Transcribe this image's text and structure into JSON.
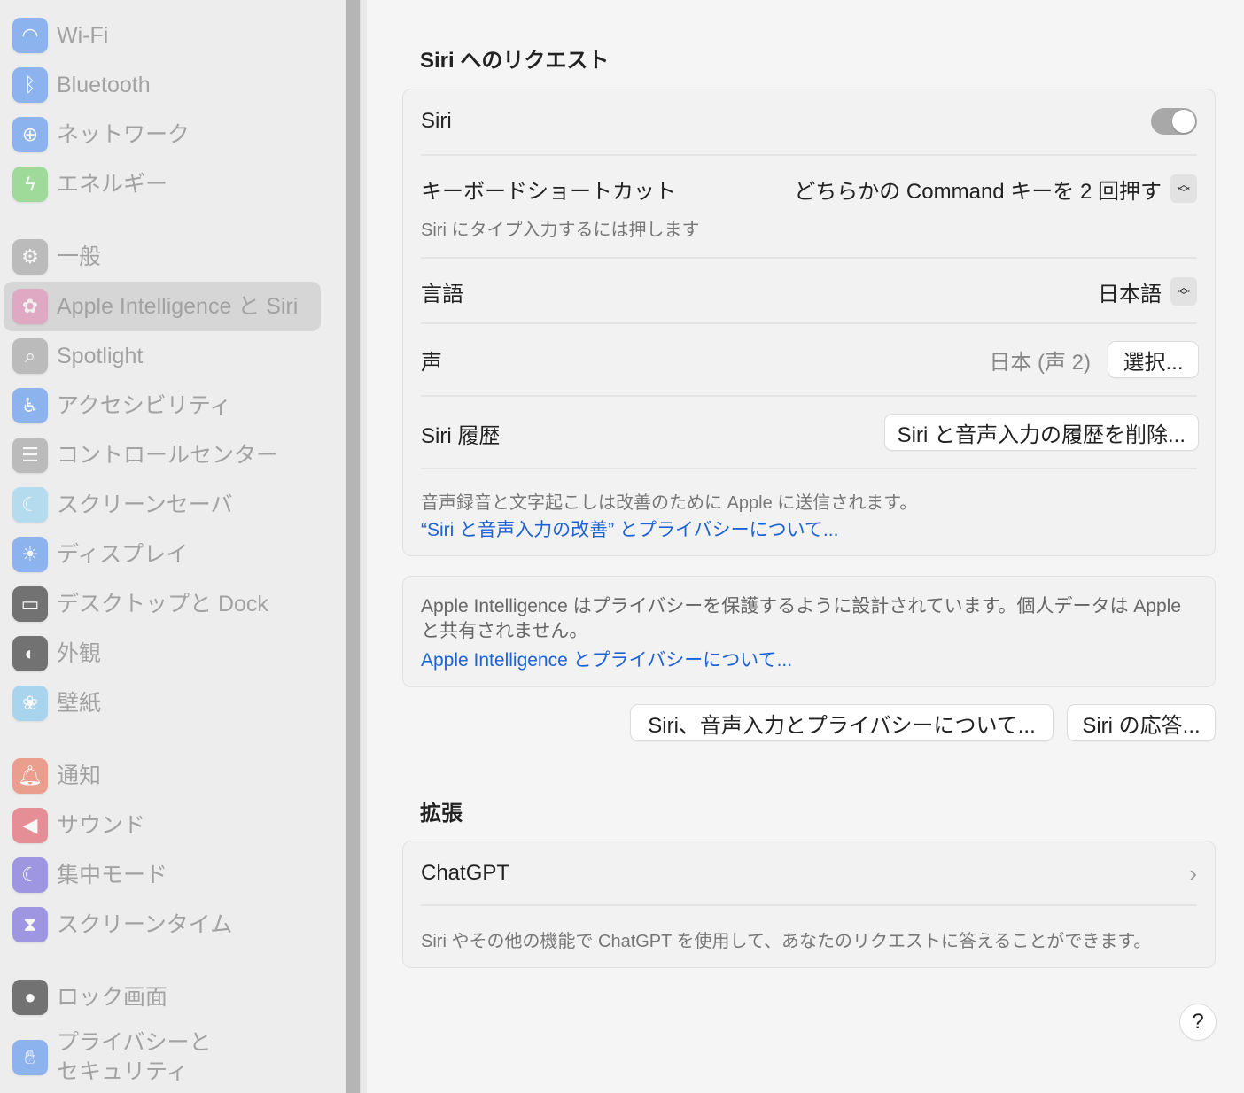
{
  "sidebar": {
    "items": [
      {
        "label": "Wi-Fi",
        "icon": "wifi-icon",
        "color": "#4f8ef0"
      },
      {
        "label": "Bluetooth",
        "icon": "bluetooth-icon",
        "color": "#4f8ef0"
      },
      {
        "label": "ネットワーク",
        "icon": "globe-icon",
        "color": "#4f8ef0"
      },
      {
        "label": "エネルギー",
        "icon": "bolt-icon",
        "color": "#6cce64"
      },
      {
        "label": "一般",
        "icon": "gear-icon",
        "color": "#9a9a9a"
      },
      {
        "label": "Apple Intelligence と Siri",
        "icon": "apple-intelligence-icon",
        "color": "#e58ab8"
      },
      {
        "label": "Spotlight",
        "icon": "magnifier-icon",
        "color": "#9a9a9a"
      },
      {
        "label": "アクセシビリティ",
        "icon": "accessibility-icon",
        "color": "#4f8ef0"
      },
      {
        "label": "コントロールセンター",
        "icon": "toggles-icon",
        "color": "#9a9a9a"
      },
      {
        "label": "スクリーンセーバ",
        "icon": "screensaver-icon",
        "color": "#8fd0f0"
      },
      {
        "label": "ディスプレイ",
        "icon": "sun-icon",
        "color": "#4f8ef0"
      },
      {
        "label": "デスクトップと Dock",
        "icon": "dock-icon",
        "color": "#222222"
      },
      {
        "label": "外観",
        "icon": "appearance-icon",
        "color": "#222222"
      },
      {
        "label": "壁紙",
        "icon": "flower-icon",
        "color": "#7cc4f0"
      },
      {
        "label": "通知",
        "icon": "bell-icon",
        "color": "#e86a50"
      },
      {
        "label": "サウンド",
        "icon": "speaker-icon",
        "color": "#e0505e"
      },
      {
        "label": "集中モード",
        "icon": "moon-icon",
        "color": "#6a5ed8"
      },
      {
        "label": "スクリーンタイム",
        "icon": "hourglass-icon",
        "color": "#6a5ed8"
      },
      {
        "label": "ロック画面",
        "icon": "lock-icon",
        "color": "#222222"
      },
      {
        "label": "プライバシーと\nセキュリティ",
        "icon": "hand-icon",
        "color": "#4f8ef0"
      }
    ]
  },
  "siri_requests": {
    "heading": "Siri へのリクエスト",
    "siri_label": "Siri",
    "siri_on": true,
    "shortcut_label": "キーボードショートカット",
    "shortcut_value": "どちらかの Command キーを 2 回押す",
    "shortcut_sub": "Siri にタイプ入力するには押します",
    "language_label": "言語",
    "language_value": "日本語",
    "voice_label": "声",
    "voice_value": "日本 (声 2)",
    "voice_button": "選択...",
    "history_label": "Siri 履歴",
    "history_button": "Siri と音声入力の履歴を削除...",
    "note": "音声録音と文字起こしは改善のために Apple に送信されます。",
    "note_link": "“Siri と音声入力の改善” とプライバシーについて..."
  },
  "privacy": {
    "text": "Apple Intelligence はプライバシーを保護するように設計されています。個人データは Apple と共有されません。",
    "link": "Apple Intelligence とプライバシーについて..."
  },
  "buttons": {
    "about": "Siri、音声入力とプライバシーについて...",
    "responses": "Siri の応答..."
  },
  "extensions": {
    "heading": "拡張",
    "chatgpt_label": "ChatGPT",
    "chatgpt_sub": "Siri やその他の機能で ChatGPT を使用して、あなたのリクエストに答えることができます。"
  },
  "help": "?"
}
